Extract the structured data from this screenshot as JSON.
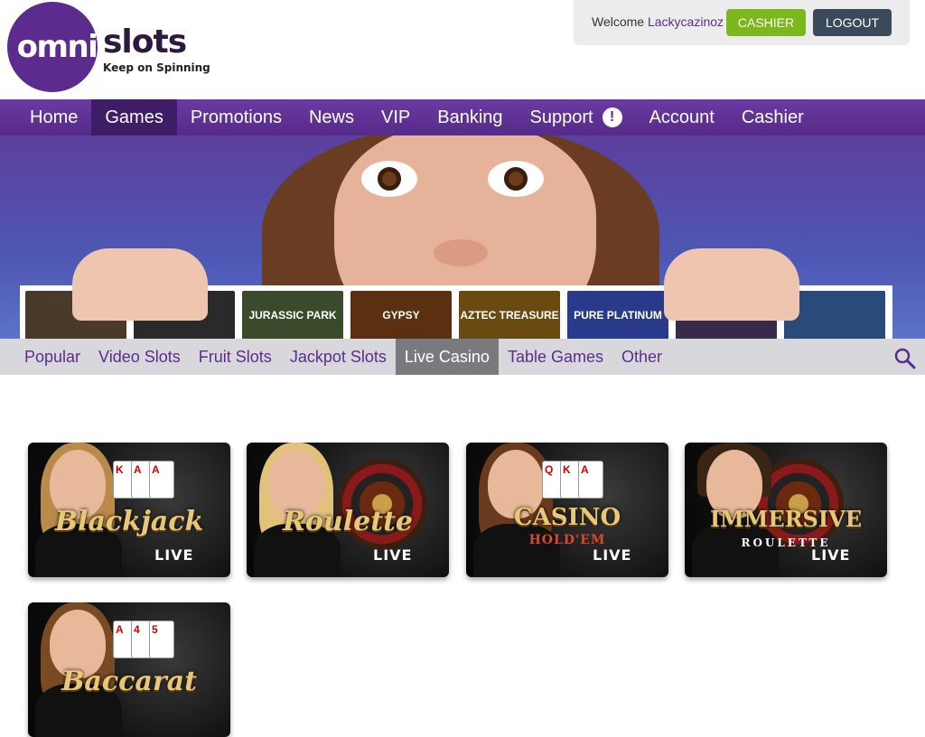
{
  "brand": {
    "logo_left": "omni",
    "logo_right": "slots",
    "tagline": "Keep on Spinning"
  },
  "user": {
    "welcome_label": "Welcome",
    "username": "Lackycazinoz",
    "cashier_label": "CASHIER",
    "logout_label": "LOGOUT"
  },
  "main_nav": [
    {
      "label": "Home",
      "active": false
    },
    {
      "label": "Games",
      "active": true
    },
    {
      "label": "Promotions",
      "active": false
    },
    {
      "label": "News",
      "active": false
    },
    {
      "label": "VIP",
      "active": false
    },
    {
      "label": "Banking",
      "active": false
    },
    {
      "label": "Support",
      "active": false,
      "alert": "!"
    },
    {
      "label": "Account",
      "active": false
    },
    {
      "label": "Cashier",
      "active": false
    }
  ],
  "hero_tiles": [
    {
      "label": "",
      "color": "#4a3a2a"
    },
    {
      "label": "",
      "color": "#2a2a2a"
    },
    {
      "label": "JURASSIC PARK",
      "color": "#3a4a2a"
    },
    {
      "label": "GYPSY",
      "color": "#5a3010"
    },
    {
      "label": "AZTEC TREASURE",
      "color": "#6a4a10"
    },
    {
      "label": "PURE PLATINUM",
      "color": "#2a3a8a"
    },
    {
      "label": "",
      "color": "#3a2a4a"
    },
    {
      "label": "",
      "color": "#2a4a7a"
    }
  ],
  "sub_nav": [
    {
      "label": "Popular",
      "active": false
    },
    {
      "label": "Video Slots",
      "active": false
    },
    {
      "label": "Fruit Slots",
      "active": false
    },
    {
      "label": "Jackpot Slots",
      "active": false
    },
    {
      "label": "Live Casino",
      "active": true
    },
    {
      "label": "Table Games",
      "active": false
    },
    {
      "label": "Other",
      "active": false
    }
  ],
  "games": [
    {
      "title": "Blackjack",
      "sub": "",
      "live": "LIVE",
      "hair": "#b98a4a",
      "feature": "cards",
      "cards": [
        "K",
        "A",
        "A"
      ]
    },
    {
      "title": "Roulette",
      "sub": "",
      "live": "LIVE",
      "hair": "#e2c27a",
      "feature": "wheel"
    },
    {
      "title": "CASINO",
      "sub": "HOLD'EM",
      "live": "LIVE",
      "hair": "#6a3a1e",
      "feature": "cards",
      "cards": [
        "Q",
        "K",
        "A"
      ]
    },
    {
      "title": "IMMERSIVE",
      "sub": "ROULETTE",
      "live": "LIVE",
      "hair": "#3a2414",
      "feature": "wheel"
    },
    {
      "title": "Baccarat",
      "sub": "",
      "live": "",
      "hair": "#7a4a24",
      "feature": "cards",
      "cards": [
        "A",
        "4",
        "5"
      ]
    }
  ],
  "colors": {
    "brand_purple": "#5b2c8e",
    "nav_purple": "#5f3096",
    "nav_active": "#3e1d66",
    "cashier_green": "#7cb81c",
    "logout_slate": "#3b4a5a",
    "subnav_bg": "#d8d8dc",
    "subnav_active": "#7a7a7e"
  },
  "icons": {
    "search": "search-icon",
    "support_alert": "exclamation-icon"
  }
}
